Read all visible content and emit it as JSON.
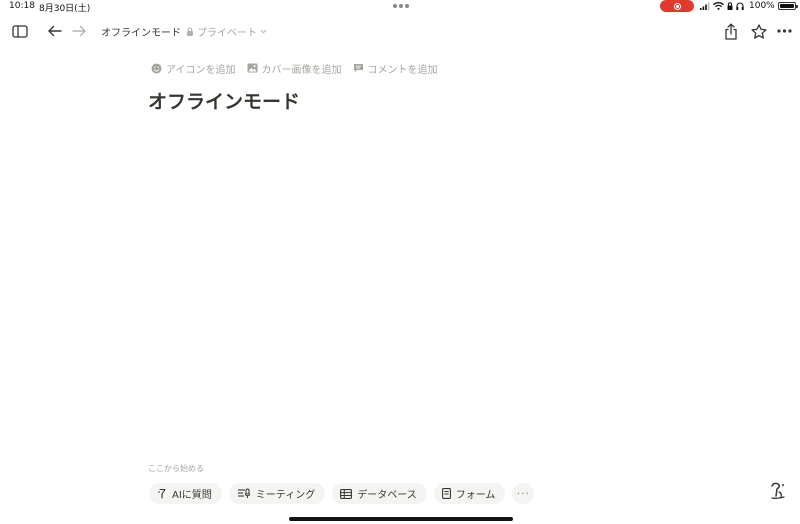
{
  "status_bar": {
    "time": "10:18",
    "date": "8月30日(土)",
    "battery_text": "100%",
    "record_color": "#e03a2f"
  },
  "toolbar": {
    "icons": [
      "sidebar-toggle-icon",
      "back-arrow-icon",
      "forward-arrow-icon",
      "share-icon",
      "star-icon",
      "more-icon"
    ],
    "breadcrumb_title": "オフラインモード",
    "privacy_label": "プライベート"
  },
  "page": {
    "actions": [
      {
        "icon": "emoji-icon",
        "label": "アイコンを追加"
      },
      {
        "icon": "image-icon",
        "label": "カバー画像を追加"
      },
      {
        "icon": "comment-icon",
        "label": "コメントを追加"
      }
    ],
    "title": "オフラインモード",
    "start_label": "ここから始める",
    "quick_actions": [
      {
        "icon": "ai-icon",
        "label": "AIに質問"
      },
      {
        "icon": "meeting-icon",
        "label": "ミーティング"
      },
      {
        "icon": "table-icon",
        "label": "データベース"
      },
      {
        "icon": "form-icon",
        "label": "フォーム"
      }
    ],
    "more_label": "···"
  }
}
